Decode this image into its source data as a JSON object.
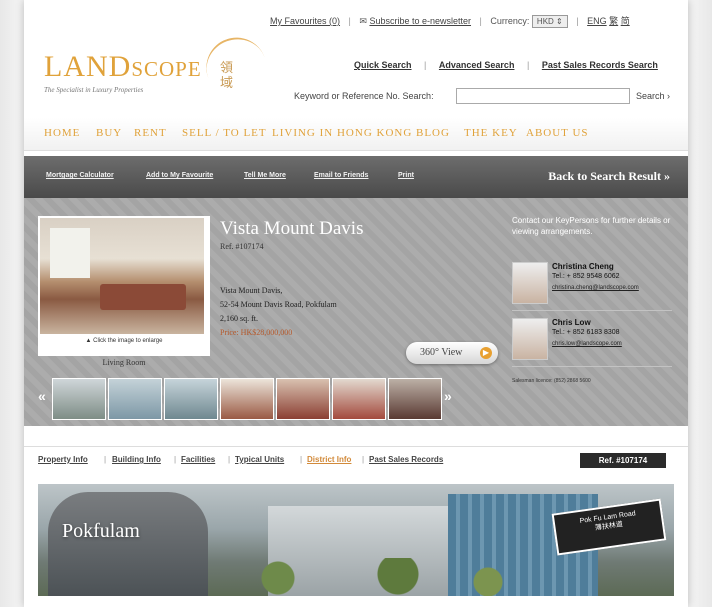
{
  "top_bar": {
    "favourites": "My Favourites (0)",
    "subscribe": "Subscribe to e-newsletter",
    "currency_label": "Currency:",
    "currency_value": "HKD",
    "lang_en": "ENG",
    "lang_tc": "繁",
    "lang_sc": "简"
  },
  "logo": {
    "name_big1": "LAND",
    "name_small": "SCOPE",
    "tagline": "The Specialist in Luxury Properties",
    "chinese": "領域"
  },
  "search": {
    "quick": "Quick Search",
    "advanced": "Advanced Search",
    "past_sales": "Past Sales Records Search",
    "keyword_label": "Keyword or Reference No. Search:",
    "keyword_value": "",
    "button": "Search ›"
  },
  "main_nav": [
    "HOME",
    "BUY",
    "RENT",
    "SELL / TO LET",
    "LIVING IN HONG KONG",
    "BLOG",
    "THE KEY",
    "ABOUT US"
  ],
  "toolbar": {
    "items": [
      "Mortgage Calculator",
      "Add to My Favourite",
      "Tell Me More",
      "Email to Friends",
      "Print"
    ],
    "back": "Back to Search Result »"
  },
  "property": {
    "title": "Vista Mount Davis",
    "ref": "Ref. #107174",
    "address_line1": "Vista Mount Davis,",
    "address_line2": "52-54 Mount Davis Road, Pokfulam",
    "size": "2,160 sq. ft.",
    "price": "Price: HK$28,000,000",
    "photo_caption": "▲ Click the image to enlarge",
    "room_label": "Living Room",
    "view360": "360° View",
    "thumbs_prev": "«",
    "thumbs_next": "»"
  },
  "contact": {
    "heading": "Contact our KeyPersons for further details or viewing arrangements.",
    "agents": [
      {
        "name": "Christina Cheng",
        "tel": "Tel.: + 852 9548 6062",
        "email": "christina.cheng@landscope.com"
      },
      {
        "name": "Chris Low",
        "tel": "Tel.: + 852 6183 8308",
        "email": "chris.low@landscope.com"
      }
    ],
    "license": "Salesman licence: (852) 2868 5600"
  },
  "tabs": {
    "items": [
      "Property Info",
      "Building Info",
      "Facilities",
      "Typical Units",
      "District Info",
      "Past Sales Records"
    ],
    "active_index": 4,
    "ref_badge": "Ref. #107174"
  },
  "banner": {
    "district": "Pokfulam",
    "sign_en": "Pok Fu Lam Road",
    "sign_cn": "薄扶林道"
  },
  "colors": {
    "accent": "#e0a23a",
    "toolbar": "#5a5a5a",
    "property_bg": "#a9a9a9",
    "active_tab": "#d28a3a"
  }
}
